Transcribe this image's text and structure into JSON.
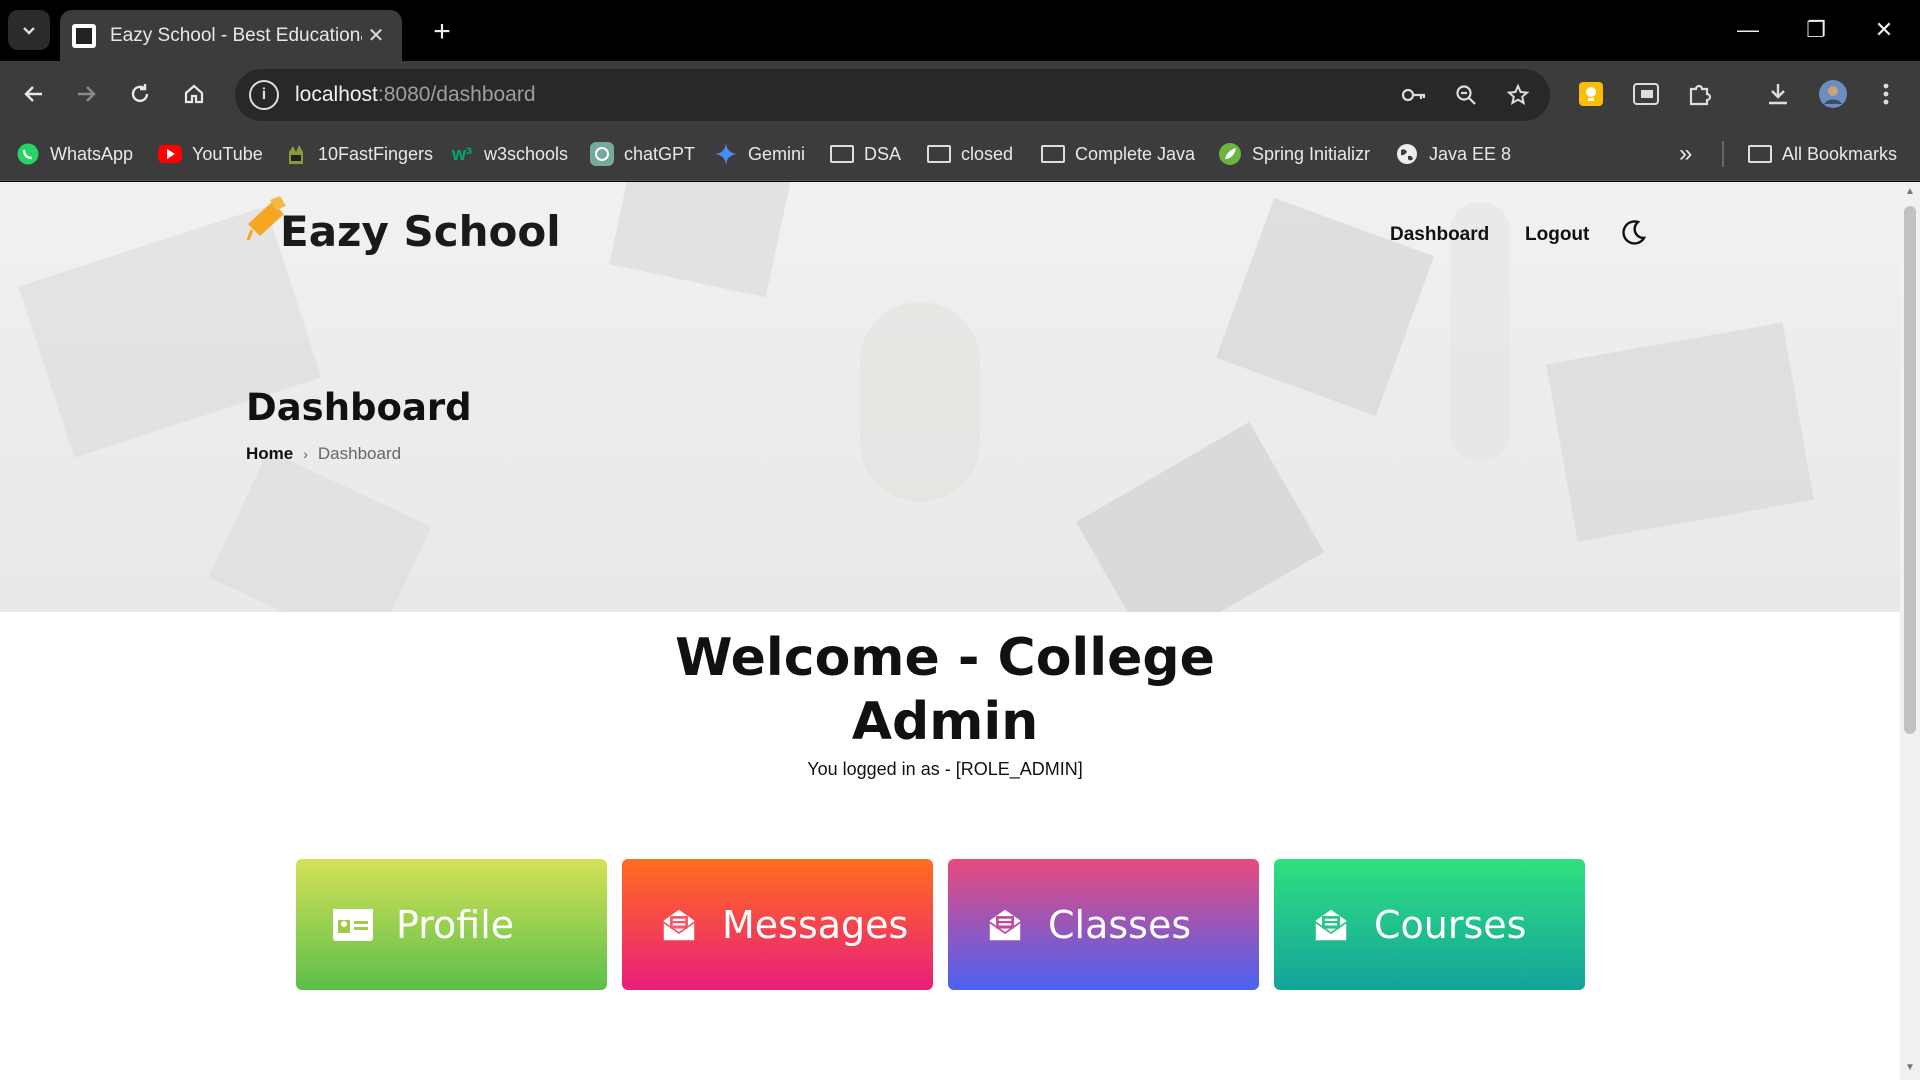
{
  "browser": {
    "tab_title": "Eazy School - Best Educational I",
    "tab_close": "✕",
    "new_tab": "+",
    "url_host": "localhost",
    "url_rest": ":8080/dashboard",
    "window": {
      "minimize": "—",
      "restore": "❐",
      "close": "✕"
    },
    "bookmarks": [
      {
        "label": "WhatsApp",
        "icon": "whatsapp-icon",
        "color": "#25d366"
      },
      {
        "label": "YouTube",
        "icon": "youtube-icon",
        "color": "#ff0000"
      },
      {
        "label": "10FastFingers",
        "icon": "10fastfingers-icon",
        "color": "#6b8e23"
      },
      {
        "label": "w3schools",
        "icon": "w3schools-icon",
        "color": "#04aa6d"
      },
      {
        "label": "chatGPT",
        "icon": "chatgpt-icon",
        "color": "#74aa9c"
      },
      {
        "label": "Gemini",
        "icon": "gemini-icon",
        "color": "#4285f4"
      },
      {
        "label": "DSA",
        "icon": "folder-icon"
      },
      {
        "label": "closed",
        "icon": "folder-icon"
      },
      {
        "label": "Complete Java",
        "icon": "folder-icon"
      },
      {
        "label": "Spring Initializr",
        "icon": "spring-icon",
        "color": "#6db33f"
      },
      {
        "label": "Java EE 8",
        "icon": "globe-icon",
        "color": "#ffffff"
      }
    ],
    "overflow": "»",
    "all_bookmarks": "All Bookmarks"
  },
  "site": {
    "logo_text": "Eazy School",
    "nav": {
      "dashboard": "Dashboard",
      "logout": "Logout"
    },
    "page_title": "Dashboard",
    "breadcrumb": {
      "home": "Home",
      "separator": "›",
      "current": "Dashboard"
    }
  },
  "main": {
    "welcome_line1": "Welcome - College",
    "welcome_line2": "Admin",
    "role_text": "You logged in as - [ROLE_ADMIN]",
    "cards": [
      {
        "label": "Profile",
        "icon": "id-card-icon",
        "gradient": [
          "#d4e157",
          "#5cbf4a"
        ]
      },
      {
        "label": "Messages",
        "icon": "envelope-icon",
        "gradient": [
          "#ff6d1f",
          "#e91e7a"
        ]
      },
      {
        "label": "Classes",
        "icon": "envelope-icon",
        "gradient": [
          "#e84a7f",
          "#4a63f0"
        ]
      },
      {
        "label": "Courses",
        "icon": "envelope-icon",
        "gradient": [
          "#2fe07f",
          "#14a39a"
        ]
      }
    ]
  },
  "colors": {
    "logo_accent": "#f5a623",
    "browser_bg": "#3c3c3c"
  }
}
